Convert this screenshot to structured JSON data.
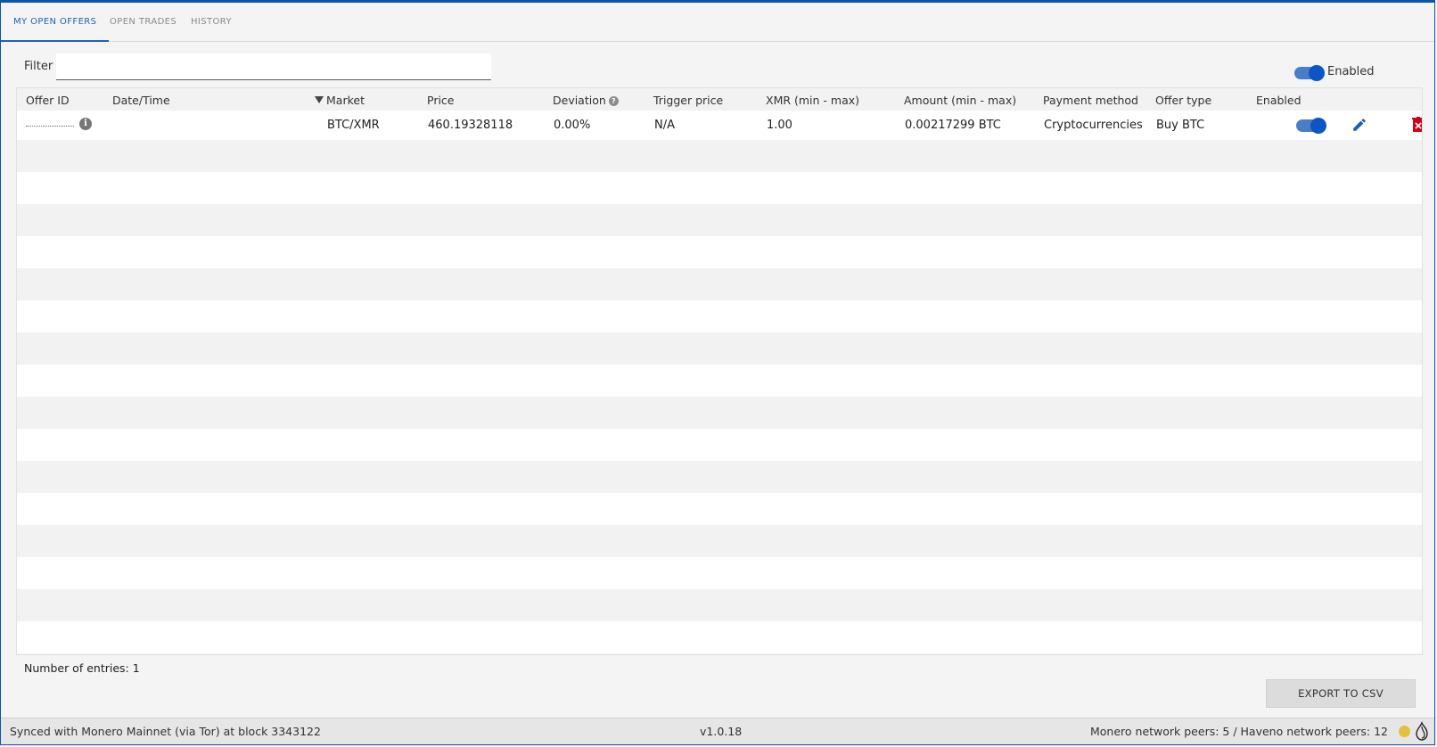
{
  "tabs": [
    {
      "label": "MY OPEN OFFERS",
      "active": true
    },
    {
      "label": "OPEN TRADES",
      "active": false
    },
    {
      "label": "HISTORY",
      "active": false
    }
  ],
  "filter": {
    "label": "Filter",
    "value": "",
    "placeholder": ""
  },
  "enabled_toggle": {
    "label": "Enabled",
    "on": true
  },
  "table": {
    "columns": [
      "Offer ID",
      "Date/Time",
      "Market",
      "Price",
      "Deviation",
      "Trigger price",
      "XMR (min - max)",
      "Amount (min - max)",
      "Payment method",
      "Offer type",
      "Enabled"
    ],
    "sorted_column": "Market",
    "rows": [
      {
        "offer_id": "",
        "date_time": "",
        "market": "BTC/XMR",
        "price": "460.19328118",
        "deviation": "0.00%",
        "trigger_price": "N/A",
        "xmr": "1.00",
        "amount": "0.00217299 BTC",
        "payment_method": "Cryptocurrencies",
        "offer_type": "Buy BTC",
        "enabled": true
      }
    ]
  },
  "entries_label": "Number of entries: 1",
  "export_label": "EXPORT TO CSV",
  "status": {
    "sync": "Synced with Monero Mainnet (via Tor) at block 3343122",
    "version": "v1.0.18",
    "peers": "Monero network peers: 5 / Haveno network peers: 12"
  },
  "colors": {
    "accent": "#1b63b8",
    "toggle_track": "#4a7dc9",
    "toggle_knob": "#0b56c4",
    "edit_icon": "#1a5fb4",
    "delete_icon": "#d0021b",
    "peer_status": "#e3c13d"
  },
  "icons": [
    "info-icon",
    "help-icon",
    "sort-desc-icon",
    "edit-pencil-icon",
    "delete-icon",
    "peer-status-dot-icon",
    "tor-onion-icon"
  ]
}
